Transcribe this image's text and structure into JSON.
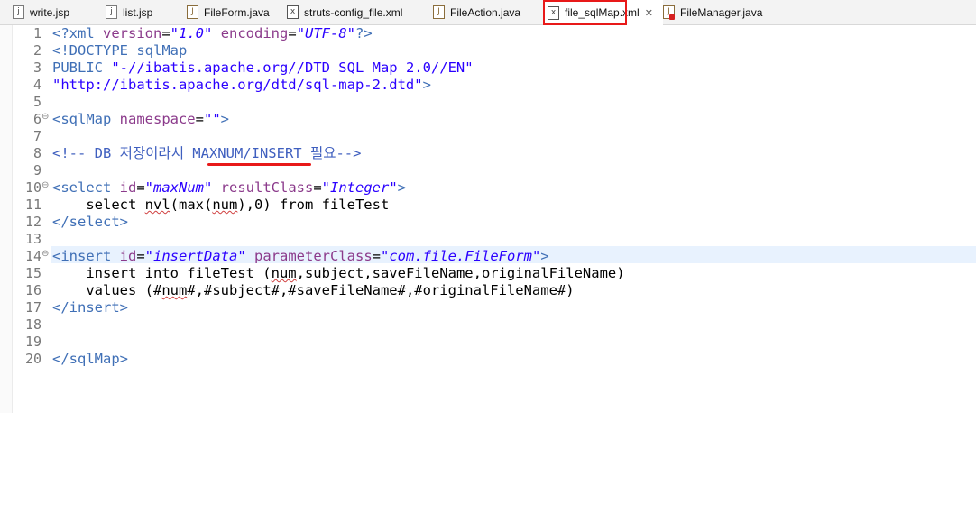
{
  "tabs": [
    {
      "label": "write.jsp",
      "icon": "jsp-file-icon"
    },
    {
      "label": "list.jsp",
      "icon": "jsp-file-icon"
    },
    {
      "label": "FileForm.java",
      "icon": "java-file-icon"
    },
    {
      "label": "struts-config_file.xml",
      "icon": "xml-file-icon"
    },
    {
      "label": "FileAction.java",
      "icon": "java-file-icon"
    },
    {
      "label": "file_sqlMap.xml",
      "icon": "xml-file-icon",
      "active": true
    },
    {
      "label": "FileManager.java",
      "icon": "java-error-file-icon"
    }
  ],
  "editor": {
    "line_numbers": [
      "1",
      "2",
      "3",
      "4",
      "5",
      "6",
      "7",
      "8",
      "9",
      "10",
      "11",
      "12",
      "13",
      "14",
      "15",
      "16",
      "17",
      "18",
      "19",
      "20"
    ],
    "lines": {
      "l1": {
        "open": "<?xml ",
        "a1": "version",
        "eq1": "=",
        "v1": "\"1.0\"",
        "sp": " ",
        "a2": "encoding",
        "eq2": "=",
        "v2": "\"UTF-8\"",
        "close": "?>"
      },
      "l2": "<!DOCTYPE sqlMap",
      "l3": {
        "kw": "PUBLIC ",
        "val": "\"-//ibatis.apache.org//DTD SQL Map 2.0//EN\""
      },
      "l4": {
        "val": "\"http://ibatis.apache.org/dtd/sql-map-2.dtd\"",
        "close": ">"
      },
      "l6": {
        "open": "<sqlMap ",
        "a1": "namespace",
        "eq1": "=",
        "v1": "\"\"",
        "close": ">"
      },
      "l8": {
        "open": "<!-- DB 저장이라서 ",
        "mid": "MAXNUM/INSERT",
        "end": " 필요-->"
      },
      "l10": {
        "open": "<select ",
        "a1": "id",
        "eq1": "=",
        "v1": "\"maxNum\"",
        "sp": " ",
        "a2": "resultClass",
        "eq2": "=",
        "v2": "\"Integer\"",
        "close": ">"
      },
      "l11": {
        "t1": "    select ",
        "sq1": "nvl",
        "t2": "(max(",
        "sq2": "num",
        "t3": "),0) from fileTest"
      },
      "l12": "</select>",
      "l14": {
        "open": "<insert ",
        "a1": "id",
        "eq1": "=",
        "v1": "\"insertData\"",
        "sp": " ",
        "a2": "parameterClass",
        "eq2": "=",
        "v2": "\"com.file.FileForm\"",
        "close": ">"
      },
      "l15": {
        "t1": "    insert into fileTest (",
        "sq1": "num",
        "t2": ",subject,saveFileName,originalFileName)"
      },
      "l16": {
        "t1": "    values (#",
        "sq1": "num",
        "t2": "#,#subject#,#saveFileName#,#originalFileName#)"
      },
      "l17": "</insert>",
      "l20": "</sqlMap>"
    }
  },
  "colors": {
    "annotation": "#e81919",
    "tag": "#3f6fb6",
    "attribute": "#8b3a8b",
    "string": "#2a00ff"
  }
}
